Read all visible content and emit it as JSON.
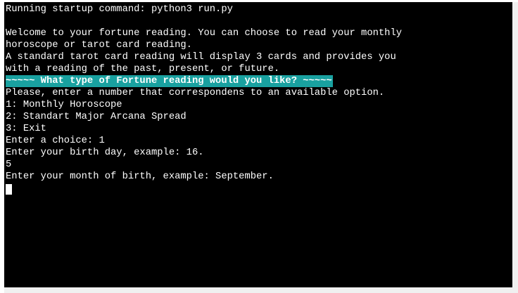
{
  "terminal": {
    "startup": "Running startup command: python3 run.py",
    "blank": "",
    "welcome_1": "Welcome to your fortune reading. You can choose to read your monthly",
    "welcome_2": "horoscope or tarot card reading.",
    "welcome_3": "A standard tarot card reading will display 3 cards and provides you",
    "welcome_4": "with a reading of the past, present, or future.",
    "menu_header": "~~~~~ What type of Fortune reading would you like? ~~~~~",
    "prompt_instruction": "Please, enter a number that correspondens to an available option.",
    "option_1": "1: Monthly Horoscope",
    "option_2": "2: Standart Major Arcana Spread",
    "option_3": "3: Exit",
    "choice_prompt": "Enter a choice: 1",
    "birth_day_prompt": "Enter your birth day, example: 16.",
    "birth_day_input": "5",
    "birth_month_prompt": "Enter your month of birth, example: September."
  },
  "colors": {
    "background": "#000000",
    "text": "#ffffff",
    "highlight": "#19a1a0"
  }
}
